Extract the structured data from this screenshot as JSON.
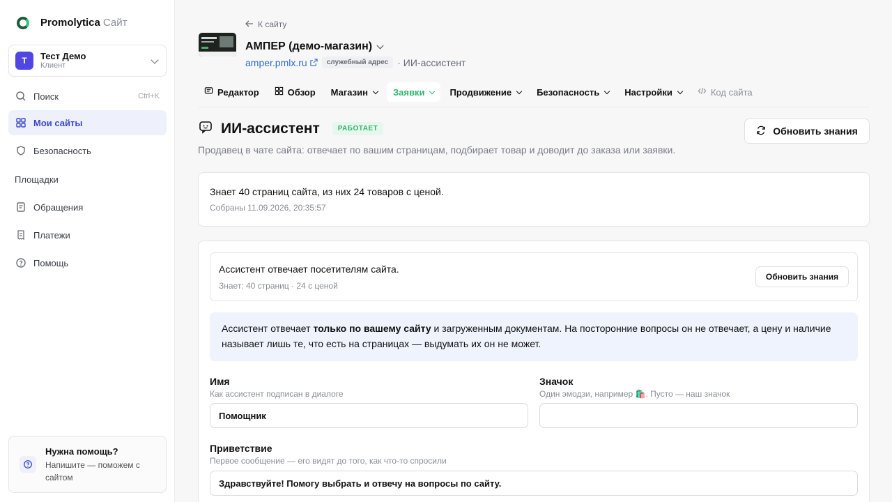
{
  "sidebar": {
    "brand": "Promolytica",
    "brand_suffix": "Сайт",
    "account": {
      "name": "Тест Демо",
      "role": "Клиент",
      "initial": "T"
    },
    "search": {
      "label": "Поиск",
      "shortcut": "Ctrl+K"
    },
    "items": [
      {
        "label": "Мои сайты",
        "icon": "grid-icon"
      },
      {
        "label": "Безопасность",
        "icon": "shield-icon"
      }
    ],
    "section": "Площадки",
    "items2": [
      {
        "label": "Обращения",
        "icon": "document-icon"
      },
      {
        "label": "Платежи",
        "icon": "receipt-icon"
      },
      {
        "label": "Помощь",
        "icon": "help-icon"
      }
    ],
    "help": {
      "title": "Нужна помощь?",
      "text": "Напишите — поможем с сайтом"
    }
  },
  "header": {
    "back": "К сайту",
    "site_title": "АМПЕР (демо-магазин)",
    "site_url": "amper.pmlx.ru",
    "tag": "служебный адрес",
    "breadcrumb": "· ИИ-ассистент"
  },
  "tabs": [
    {
      "label": "Редактор"
    },
    {
      "label": "Обзор"
    },
    {
      "label": "Магазин"
    },
    {
      "label": "Заявки"
    },
    {
      "label": "Продвижение"
    },
    {
      "label": "Безопасность"
    },
    {
      "label": "Настройки"
    },
    {
      "label": "Код сайта"
    }
  ],
  "page": {
    "title": "ИИ-ассистент",
    "status": "РАБОТАЕТ",
    "description": "Продавец в чате сайта: отвечает по вашим страницам, подбирает товар и доводит до заказа или заявки.",
    "refresh_label": "Обновить знания"
  },
  "summary": {
    "line1": "Знает 40 страниц сайта, из них 24 товаров с ценой.",
    "line2": "Собраны 11.09.2026, 20:35:57"
  },
  "assistant": {
    "line1": "Ассистент отвечает посетителям сайта.",
    "line2": "Знает: 40 страниц · 24 с ценой",
    "refresh_label": "Обновить знания",
    "info_pre": "Ассистент отвечает ",
    "info_bold": "только по вашему сайту",
    "info_post": " и загруженным документам. На посторонние вопросы он не отвечает, а цену и наличие называет лишь те, что есть на страницах — выдумать их он не может."
  },
  "form": {
    "name": {
      "label": "Имя",
      "hint": "Как ассистент подписан в диалоге",
      "value": "Помощник"
    },
    "badge": {
      "label": "Значок",
      "hint": "Один эмодзи, например 🛍️. Пусто — наш значок",
      "value": ""
    },
    "greeting": {
      "label": "Приветствие",
      "hint": "Первое сообщение — его видят до того, как что-то спросили",
      "value": "Здравствуйте! Помогу выбрать и отвечу на вопросы по сайту."
    }
  },
  "colors": {
    "accent": "#3a49c9",
    "success": "#2fb56d",
    "link": "#2f6ed1",
    "avatar": "#5046e5"
  }
}
